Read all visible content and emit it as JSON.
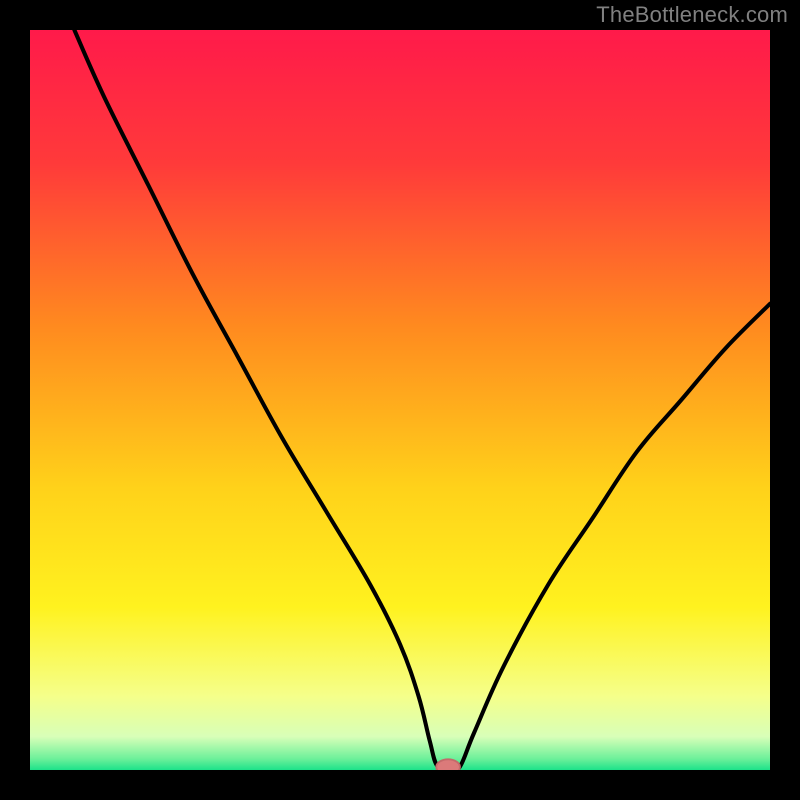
{
  "watermark": "TheBottleneck.com",
  "chart_data": {
    "type": "line",
    "title": "",
    "xlabel": "",
    "ylabel": "",
    "xlim": [
      0,
      100
    ],
    "ylim": [
      0,
      100
    ],
    "grid": false,
    "legend": false,
    "background_gradient": {
      "stops": [
        {
          "pos": 0.0,
          "color": "#ff1a4a"
        },
        {
          "pos": 0.18,
          "color": "#ff3a3a"
        },
        {
          "pos": 0.4,
          "color": "#ff8a1f"
        },
        {
          "pos": 0.62,
          "color": "#ffd21a"
        },
        {
          "pos": 0.78,
          "color": "#fff21f"
        },
        {
          "pos": 0.9,
          "color": "#f5ff8a"
        },
        {
          "pos": 0.955,
          "color": "#d8ffb8"
        },
        {
          "pos": 0.985,
          "color": "#6cf09a"
        },
        {
          "pos": 1.0,
          "color": "#1ce28a"
        }
      ]
    },
    "series": [
      {
        "name": "bottleneck-curve",
        "color": "#000000",
        "x": [
          6,
          10,
          16,
          22,
          28,
          34,
          40,
          46,
          50,
          52.5,
          54,
          55,
          56.5,
          58,
          60,
          64,
          70,
          76,
          82,
          88,
          94,
          100
        ],
        "y_pct": [
          100,
          91,
          79,
          67,
          56,
          45,
          35,
          25,
          17,
          10,
          4,
          0.6,
          0.3,
          0.3,
          5,
          14,
          25,
          34,
          43,
          50,
          57,
          63
        ]
      }
    ],
    "marker": {
      "name": "optimal-point",
      "x": 56.5,
      "y_pct": 0.4,
      "rx": 1.6,
      "ry": 1.05,
      "fill": "#db7a7a",
      "stroke": "#c46a6a"
    }
  }
}
